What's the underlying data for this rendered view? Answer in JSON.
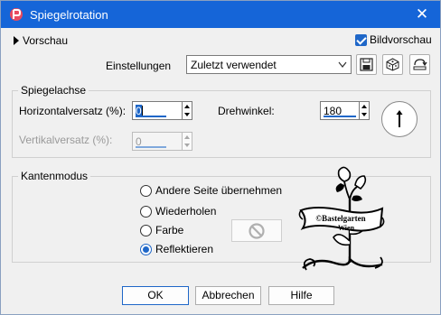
{
  "window": {
    "title": "Spiegelrotation",
    "close_glyph": "✕"
  },
  "preview": {
    "toggle_label": "Vorschau",
    "image_preview_label": "Bildvorschau",
    "image_preview_checked": true
  },
  "settings": {
    "label": "Einstellungen",
    "selected": "Zuletzt verwendet",
    "icons": [
      "save-icon",
      "randomize-icon",
      "reset-icon"
    ]
  },
  "mirror_axis": {
    "legend": "Spiegelachse",
    "horizontal_offset_label": "Horizontalversatz (%):",
    "horizontal_offset_value": "0",
    "vertical_offset_label": "Vertikalversatz (%):",
    "vertical_offset_value": "0",
    "rotation_label": "Drehwinkel:",
    "rotation_value": "180"
  },
  "edge_mode": {
    "legend": "Kantenmodus",
    "options": [
      {
        "label": "Andere Seite übernehmen",
        "selected": false
      },
      {
        "label": "Wiederholen",
        "selected": false
      },
      {
        "label": "Farbe",
        "selected": false
      },
      {
        "label": "Reflektieren",
        "selected": true
      }
    ]
  },
  "watermark": {
    "text_line1": "©Bastelgarten",
    "text_line2": "Wien"
  },
  "buttons": {
    "ok": "OK",
    "cancel": "Abbrechen",
    "help": "Hilfe"
  },
  "colors": {
    "titlebar": "#1565d8",
    "accent": "#1f67c8",
    "window_bg": "#f0f0f0"
  }
}
